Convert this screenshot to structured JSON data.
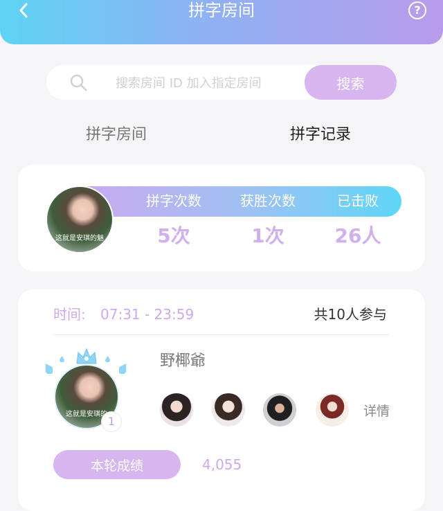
{
  "header": {
    "title": "拼字房间",
    "help_label": "?"
  },
  "search": {
    "placeholder": "搜索房间 ID 加入指定房间",
    "value": "",
    "button_label": "搜索"
  },
  "tabs": [
    {
      "label": "拼字房间",
      "active": false
    },
    {
      "label": "拼字记录",
      "active": true
    }
  ],
  "summary": {
    "avatar_caption": "这就是安琪的魅",
    "stats": [
      {
        "label": "拼字次数",
        "value": "5次"
      },
      {
        "label": "获胜次数",
        "value": "1次"
      },
      {
        "label": "已击败",
        "value": "26人"
      }
    ]
  },
  "record": {
    "time_label": "时间:",
    "time_value": "07:31 - 23:59",
    "participants": "共10人参与",
    "username": "野椰爺",
    "avatar_caption": "这就是安琪的",
    "rank": "1",
    "details_label": "详情",
    "score_label": "本轮成绩",
    "score_value": "4,055"
  },
  "colors": {
    "accent": "#d7b5ef",
    "accent_text": "#cfa8ec",
    "header_start": "#5ed4f3",
    "header_end": "#b89bea"
  }
}
